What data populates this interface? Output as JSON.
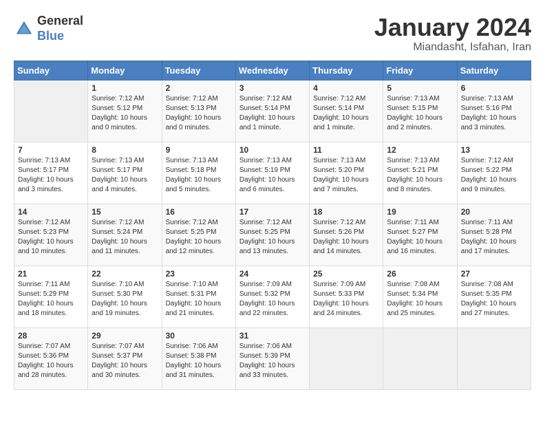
{
  "logo": {
    "general": "General",
    "blue": "Blue"
  },
  "title": "January 2024",
  "subtitle": "Miandasht, Isfahan, Iran",
  "days_of_week": [
    "Sunday",
    "Monday",
    "Tuesday",
    "Wednesday",
    "Thursday",
    "Friday",
    "Saturday"
  ],
  "weeks": [
    [
      {
        "day": "",
        "info": ""
      },
      {
        "day": "1",
        "info": "Sunrise: 7:12 AM\nSunset: 5:12 PM\nDaylight: 10 hours\nand 0 minutes."
      },
      {
        "day": "2",
        "info": "Sunrise: 7:12 AM\nSunset: 5:13 PM\nDaylight: 10 hours\nand 0 minutes."
      },
      {
        "day": "3",
        "info": "Sunrise: 7:12 AM\nSunset: 5:14 PM\nDaylight: 10 hours\nand 1 minute."
      },
      {
        "day": "4",
        "info": "Sunrise: 7:12 AM\nSunset: 5:14 PM\nDaylight: 10 hours\nand 1 minute."
      },
      {
        "day": "5",
        "info": "Sunrise: 7:13 AM\nSunset: 5:15 PM\nDaylight: 10 hours\nand 2 minutes."
      },
      {
        "day": "6",
        "info": "Sunrise: 7:13 AM\nSunset: 5:16 PM\nDaylight: 10 hours\nand 3 minutes."
      }
    ],
    [
      {
        "day": "7",
        "info": "Sunrise: 7:13 AM\nSunset: 5:17 PM\nDaylight: 10 hours\nand 3 minutes."
      },
      {
        "day": "8",
        "info": "Sunrise: 7:13 AM\nSunset: 5:17 PM\nDaylight: 10 hours\nand 4 minutes."
      },
      {
        "day": "9",
        "info": "Sunrise: 7:13 AM\nSunset: 5:18 PM\nDaylight: 10 hours\nand 5 minutes."
      },
      {
        "day": "10",
        "info": "Sunrise: 7:13 AM\nSunset: 5:19 PM\nDaylight: 10 hours\nand 6 minutes."
      },
      {
        "day": "11",
        "info": "Sunrise: 7:13 AM\nSunset: 5:20 PM\nDaylight: 10 hours\nand 7 minutes."
      },
      {
        "day": "12",
        "info": "Sunrise: 7:13 AM\nSunset: 5:21 PM\nDaylight: 10 hours\nand 8 minutes."
      },
      {
        "day": "13",
        "info": "Sunrise: 7:12 AM\nSunset: 5:22 PM\nDaylight: 10 hours\nand 9 minutes."
      }
    ],
    [
      {
        "day": "14",
        "info": "Sunrise: 7:12 AM\nSunset: 5:23 PM\nDaylight: 10 hours\nand 10 minutes."
      },
      {
        "day": "15",
        "info": "Sunrise: 7:12 AM\nSunset: 5:24 PM\nDaylight: 10 hours\nand 11 minutes."
      },
      {
        "day": "16",
        "info": "Sunrise: 7:12 AM\nSunset: 5:25 PM\nDaylight: 10 hours\nand 12 minutes."
      },
      {
        "day": "17",
        "info": "Sunrise: 7:12 AM\nSunset: 5:25 PM\nDaylight: 10 hours\nand 13 minutes."
      },
      {
        "day": "18",
        "info": "Sunrise: 7:12 AM\nSunset: 5:26 PM\nDaylight: 10 hours\nand 14 minutes."
      },
      {
        "day": "19",
        "info": "Sunrise: 7:11 AM\nSunset: 5:27 PM\nDaylight: 10 hours\nand 16 minutes."
      },
      {
        "day": "20",
        "info": "Sunrise: 7:11 AM\nSunset: 5:28 PM\nDaylight: 10 hours\nand 17 minutes."
      }
    ],
    [
      {
        "day": "21",
        "info": "Sunrise: 7:11 AM\nSunset: 5:29 PM\nDaylight: 10 hours\nand 18 minutes."
      },
      {
        "day": "22",
        "info": "Sunrise: 7:10 AM\nSunset: 5:30 PM\nDaylight: 10 hours\nand 19 minutes."
      },
      {
        "day": "23",
        "info": "Sunrise: 7:10 AM\nSunset: 5:31 PM\nDaylight: 10 hours\nand 21 minutes."
      },
      {
        "day": "24",
        "info": "Sunrise: 7:09 AM\nSunset: 5:32 PM\nDaylight: 10 hours\nand 22 minutes."
      },
      {
        "day": "25",
        "info": "Sunrise: 7:09 AM\nSunset: 5:33 PM\nDaylight: 10 hours\nand 24 minutes."
      },
      {
        "day": "26",
        "info": "Sunrise: 7:08 AM\nSunset: 5:34 PM\nDaylight: 10 hours\nand 25 minutes."
      },
      {
        "day": "27",
        "info": "Sunrise: 7:08 AM\nSunset: 5:35 PM\nDaylight: 10 hours\nand 27 minutes."
      }
    ],
    [
      {
        "day": "28",
        "info": "Sunrise: 7:07 AM\nSunset: 5:36 PM\nDaylight: 10 hours\nand 28 minutes."
      },
      {
        "day": "29",
        "info": "Sunrise: 7:07 AM\nSunset: 5:37 PM\nDaylight: 10 hours\nand 30 minutes."
      },
      {
        "day": "30",
        "info": "Sunrise: 7:06 AM\nSunset: 5:38 PM\nDaylight: 10 hours\nand 31 minutes."
      },
      {
        "day": "31",
        "info": "Sunrise: 7:06 AM\nSunset: 5:39 PM\nDaylight: 10 hours\nand 33 minutes."
      },
      {
        "day": "",
        "info": ""
      },
      {
        "day": "",
        "info": ""
      },
      {
        "day": "",
        "info": ""
      }
    ]
  ]
}
